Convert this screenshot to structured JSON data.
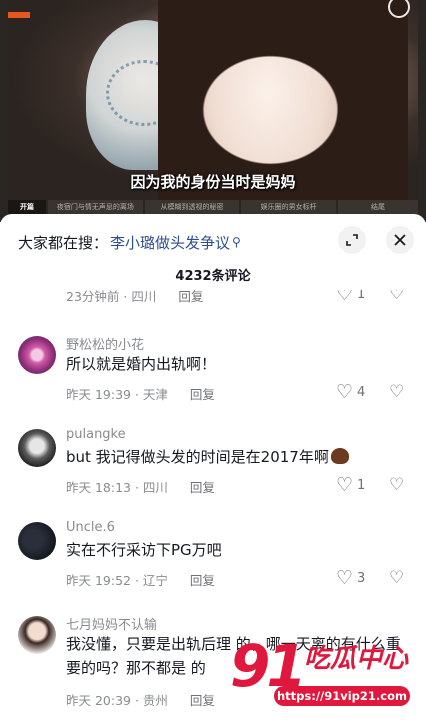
{
  "video": {
    "caption": "因为我的身份当时是妈妈",
    "banner": "",
    "chapters": [
      {
        "label": "开篇"
      },
      {
        "label": "夜宿门与情无声息的离场"
      },
      {
        "label": "从模糊到透视的秘密"
      },
      {
        "label": "娱乐圈的男女标杆"
      },
      {
        "label": "结尾"
      }
    ]
  },
  "header": {
    "search_label": "大家都在搜：",
    "search_term": "李小璐做头发争议",
    "search_icon": "search-icon",
    "expand_icon": "expand-icon",
    "close_icon": "close-icon",
    "comment_count": "4232条评论"
  },
  "comments": [
    {
      "username": "",
      "text": "",
      "time": "23分钟前 · 四川",
      "reply": "回复",
      "likes": "1"
    },
    {
      "username": "野松松的小花",
      "text": "所以就是婚内出轨啊！",
      "time": "昨天 19:39 · 天津",
      "reply": "回复",
      "likes": "4"
    },
    {
      "username": "pulangke",
      "text": "but  我记得做头发的时间是在2017年啊",
      "time": "昨天 18:13 · 四川",
      "reply": "回复",
      "likes": "1"
    },
    {
      "username": "Uncle.6",
      "text": "实在不行采访下PG万吧",
      "time": "昨天 19:52 · 辽宁",
      "reply": "回复",
      "likes": "3"
    },
    {
      "username": "七月妈妈不认输",
      "text": "我没懂，只要是出轨后理 的，哪一天离的有什么重要的吗？那不都是 的 ",
      "time": "昨天 20:39 · 贵州",
      "reply": "回复",
      "likes": ""
    }
  ],
  "watermark": {
    "number": "91",
    "name": "吃瓜中心",
    "url": "https://91vip21.com"
  }
}
